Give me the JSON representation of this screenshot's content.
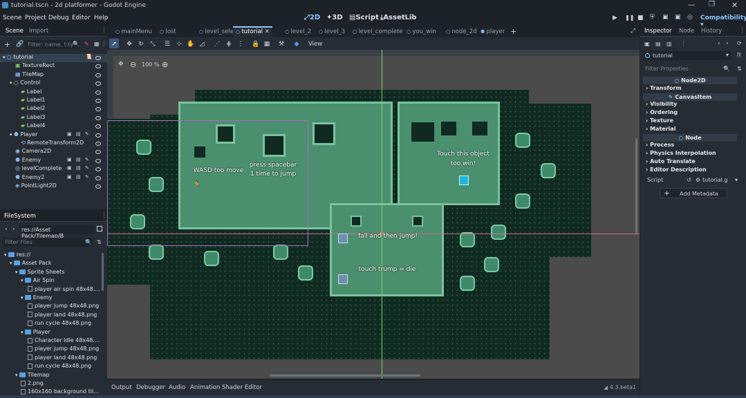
{
  "window": {
    "title": "tutorial.tscn - 2d platformer - Godot Engine"
  },
  "menus": [
    "Scene",
    "Project",
    "Debug",
    "Editor",
    "Help"
  ],
  "workspaces": {
    "w2d": "2D",
    "w3d": "3D",
    "script": "Script",
    "assetlib": "AssetLib"
  },
  "renderer": "Compatibility",
  "scene_dock": {
    "tabs": [
      "Scene",
      "Import"
    ],
    "filter_placeholder": "Filter: name, t:ty",
    "nodes": [
      {
        "label": "tutorial",
        "icon": "node2d-icon"
      },
      {
        "label": "TextureRect",
        "icon": "texturerect-icon"
      },
      {
        "label": "TileMap",
        "icon": "tilemap-icon"
      },
      {
        "label": "Control",
        "icon": "control-icon"
      },
      {
        "label": "Label",
        "icon": "label-icon"
      },
      {
        "label": "Label1",
        "icon": "label-icon"
      },
      {
        "label": "Label2",
        "icon": "label-icon"
      },
      {
        "label": "Label3",
        "icon": "label-icon"
      },
      {
        "label": "Label4",
        "icon": "label-icon"
      },
      {
        "label": "Player",
        "icon": "character-icon"
      },
      {
        "label": "RemoteTransform2D",
        "icon": "remote-transform-icon"
      },
      {
        "label": "Camera2D",
        "icon": "camera-icon"
      },
      {
        "label": "Enemy",
        "icon": "character-icon"
      },
      {
        "label": "levelComplete",
        "icon": "area-icon"
      },
      {
        "label": "Enemy2",
        "icon": "character-icon"
      },
      {
        "label": "PointLight2D",
        "icon": "light-icon"
      }
    ]
  },
  "filesystem": {
    "title": "FileSystem",
    "path": "res://Asset Pack/Tilemap/B",
    "filter_placeholder": "Filter Files",
    "items": [
      {
        "label": "res://",
        "kind": "folder"
      },
      {
        "label": "Asset Pack",
        "kind": "folder"
      },
      {
        "label": "Sprite Sheets",
        "kind": "folder"
      },
      {
        "label": "Air Spin",
        "kind": "folder"
      },
      {
        "label": "player air spin 48x48....",
        "kind": "file"
      },
      {
        "label": "Enemy",
        "kind": "folder"
      },
      {
        "label": "player jump 48x48.png",
        "kind": "file"
      },
      {
        "label": "player land 48x48.png",
        "kind": "file"
      },
      {
        "label": "run cycle 48x48.png",
        "kind": "file"
      },
      {
        "label": "Player",
        "kind": "folder"
      },
      {
        "label": "Character Idle 48x48....",
        "kind": "file"
      },
      {
        "label": "player jump 48x48.png",
        "kind": "file"
      },
      {
        "label": "player land 48x48.png",
        "kind": "file"
      },
      {
        "label": "run cycle 48x48.png",
        "kind": "file"
      },
      {
        "label": "Tilemap",
        "kind": "folder"
      },
      {
        "label": "2.png",
        "kind": "file"
      },
      {
        "label": "160x160 background til...",
        "kind": "file"
      }
    ]
  },
  "scene_tabs": [
    "mainMenu",
    "lost",
    "level_selection",
    "tutorial",
    "level_2",
    "level_3",
    "level_complete",
    "you_win",
    "node_2d",
    "player"
  ],
  "toolbar": {
    "view": "View",
    "zoom": "100 %"
  },
  "viewport_labels": {
    "wasd": "WASD too move",
    "spacebar": "press spacebar\n1 time to jump",
    "touch": "Touch this object\ntoo win!",
    "fall": "fall and then jump!",
    "trump": "touch trump = die"
  },
  "bottom_tabs": [
    "Output",
    "Debugger",
    "Audio",
    "Animation",
    "Shader Editor"
  ],
  "version": "4.3.beta1",
  "inspector": {
    "tabs": [
      "Inspector",
      "Node",
      "History"
    ],
    "object": "tutorial",
    "filter_placeholder": "Filter Properties",
    "sections": [
      {
        "kind": "class",
        "label": "Node2D"
      },
      {
        "kind": "group",
        "label": "Transform"
      },
      {
        "kind": "class",
        "label": "CanvasItem"
      },
      {
        "kind": "group",
        "label": "Visibility"
      },
      {
        "kind": "group",
        "label": "Ordering"
      },
      {
        "kind": "group",
        "label": "Texture"
      },
      {
        "kind": "group",
        "label": "Material"
      },
      {
        "kind": "class",
        "label": "Node"
      },
      {
        "kind": "group",
        "label": "Process"
      },
      {
        "kind": "group",
        "label": "Physics Interpolation"
      },
      {
        "kind": "group",
        "label": "Auto Translate"
      },
      {
        "kind": "group",
        "label": "Editor Description"
      }
    ],
    "script_label": "Script",
    "script_value": "tutorial.g",
    "add_metadata": "Add Metadata"
  }
}
